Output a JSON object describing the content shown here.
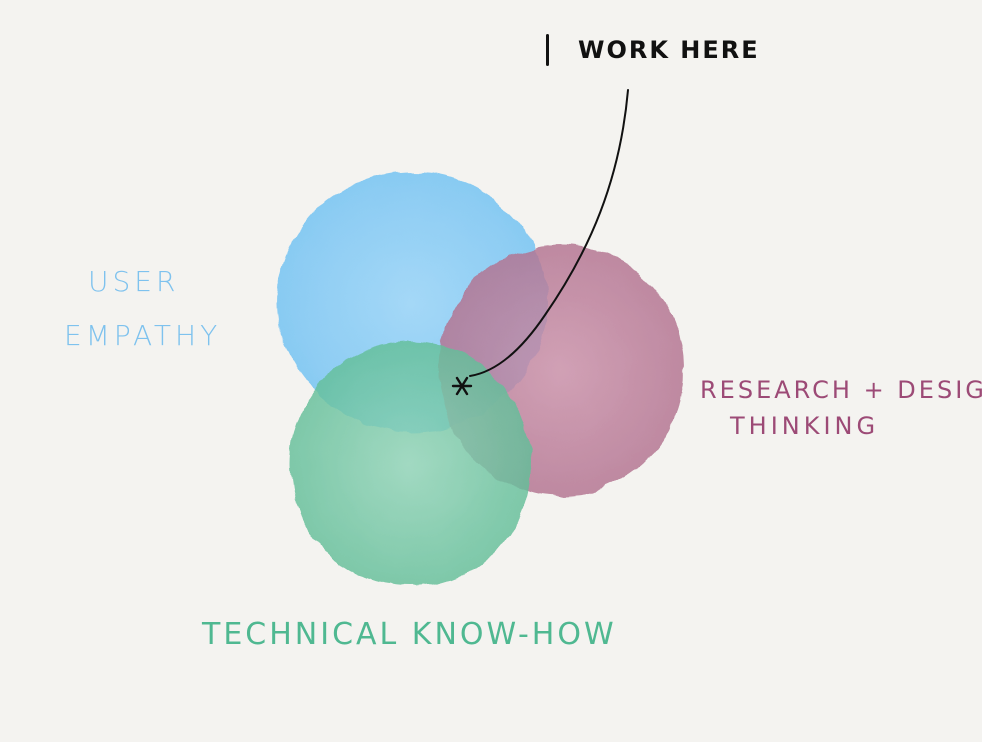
{
  "sets": [
    {
      "id": "user-empathy",
      "lines": [
        "USER",
        "EMPATHY"
      ],
      "color": "#8ecdf5"
    },
    {
      "id": "research-design",
      "lines": [
        "RESEARCH + DESIGN",
        "THINKING"
      ],
      "color": "#b8708f"
    },
    {
      "id": "technical",
      "lines": [
        "TECHNICAL KNOW-HOW"
      ],
      "color": "#72c4a3"
    }
  ],
  "annotation": {
    "text": "WORK HERE",
    "marker": "*"
  },
  "colors": {
    "background": "#f4f3f0",
    "label_user": "#7ec2ee",
    "label_research": "#9c4a76",
    "label_tech": "#4fb891",
    "ink": "#111111"
  }
}
